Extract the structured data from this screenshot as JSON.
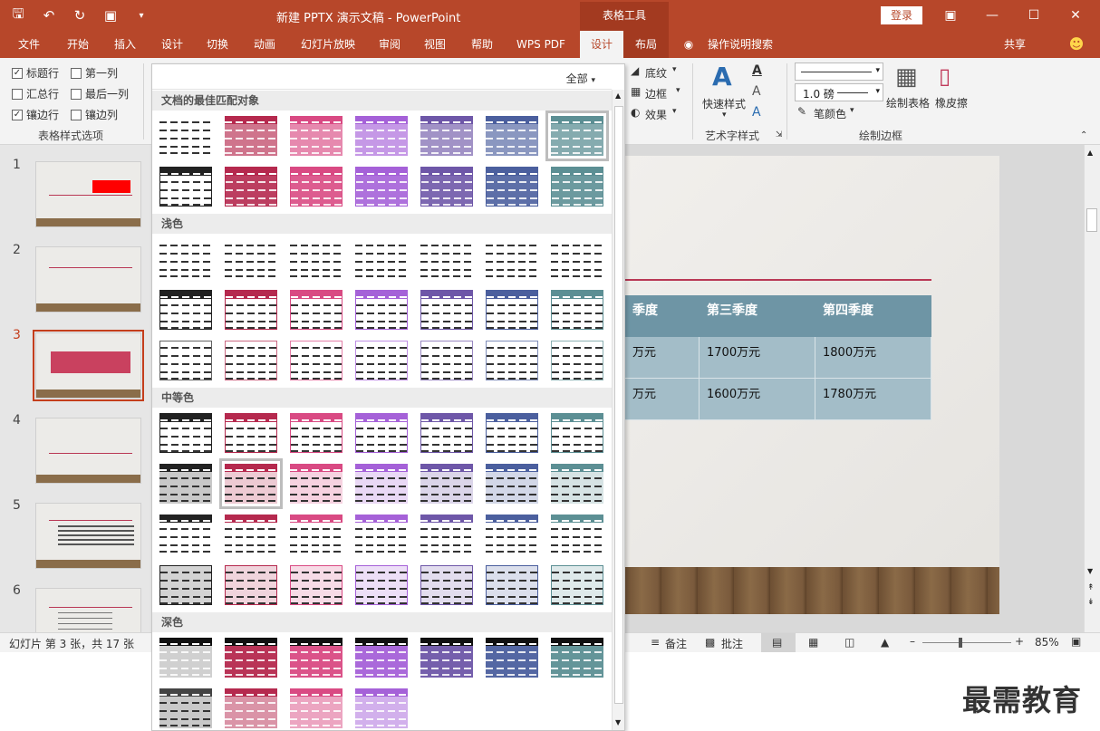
{
  "titlebar": {
    "title": "新建 PPTX 演示文稿 - PowerPoint",
    "context_tab_group": "表格工具",
    "login": "登录"
  },
  "tabs": [
    {
      "label": "文件"
    },
    {
      "label": "开始"
    },
    {
      "label": "插入"
    },
    {
      "label": "设计"
    },
    {
      "label": "切换"
    },
    {
      "label": "动画"
    },
    {
      "label": "幻灯片放映"
    },
    {
      "label": "审阅"
    },
    {
      "label": "视图"
    },
    {
      "label": "帮助"
    },
    {
      "label": "WPS PDF"
    },
    {
      "label": "设计"
    },
    {
      "label": "布局"
    },
    {
      "label": "操作说明搜索"
    },
    {
      "label": "共享"
    }
  ],
  "ribbon": {
    "style_options": {
      "title": "表格样式选项",
      "header_row": "标题行",
      "first_col": "第一列",
      "total_row": "汇总行",
      "last_col": "最后一列",
      "banded_rows": "镶边行",
      "banded_cols": "镶边列"
    },
    "shading": "底纹",
    "borders": "边框",
    "effects": "效果",
    "quick_styles": "快速样式",
    "wordart_title": "艺术字样式",
    "pen_weight": "1.0 磅",
    "pen_color": "笔颜色",
    "draw_table": "绘制表格",
    "eraser": "橡皮擦",
    "draw_borders_title": "绘制边框"
  },
  "gallery": {
    "filter": "全部",
    "sections": {
      "best": "文档的最佳匹配对象",
      "light": "浅色",
      "medium": "中等色",
      "dark": "深色"
    },
    "palette": [
      "#222222",
      "#b5294e",
      "#d94a83",
      "#a561d8",
      "#6e57a8",
      "#4b5f9e",
      "#5c8f94"
    ]
  },
  "slides": {
    "numbers": [
      "1",
      "2",
      "3",
      "4",
      "5",
      "6"
    ],
    "current": "3"
  },
  "slide_table": {
    "headers": [
      "季度",
      "第三季度",
      "第四季度"
    ],
    "rows": [
      [
        "万元",
        "1700万元",
        "1800万元"
      ],
      [
        "万元",
        "1600万元",
        "1780万元"
      ]
    ]
  },
  "statusbar": {
    "slide_info": "幻灯片 第 3 张，共 17 张",
    "notes": "备注",
    "comments": "批注",
    "zoom": "85%"
  },
  "watermark": "最需教育"
}
